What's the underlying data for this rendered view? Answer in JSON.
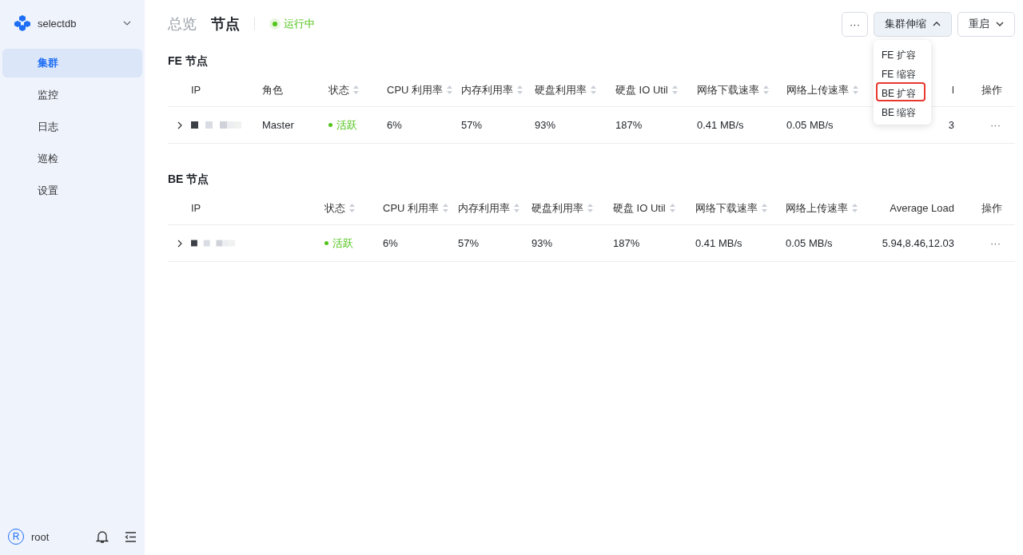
{
  "sidebar": {
    "workspace": "selectdb",
    "items": [
      {
        "label": "集群",
        "selected": true
      },
      {
        "label": "监控",
        "selected": false
      },
      {
        "label": "日志",
        "selected": false
      },
      {
        "label": "巡检",
        "selected": false
      },
      {
        "label": "设置",
        "selected": false
      }
    ],
    "user": {
      "initial": "R",
      "name": "root"
    }
  },
  "header": {
    "breadcrumbs": [
      {
        "label": "总览",
        "selected": false
      },
      {
        "label": "节点",
        "selected": true
      }
    ],
    "status": {
      "label": "运行中",
      "color": "#52c41a"
    },
    "more_button": "···",
    "scale_button": {
      "label": "集群伸缩",
      "expanded": true
    },
    "restart_button": {
      "label": "重启",
      "expanded": false
    },
    "menu": [
      {
        "label": "FE 扩容",
        "highlighted": false
      },
      {
        "label": "FE 缩容",
        "highlighted": false
      },
      {
        "label": "BE 扩容",
        "highlighted": true
      },
      {
        "label": "BE 缩容",
        "highlighted": false
      }
    ]
  },
  "tables": [
    {
      "title": "FE 节点",
      "columns": [
        {
          "label": "IP",
          "sortable": false
        },
        {
          "label": "角色",
          "sortable": false
        },
        {
          "label": "状态",
          "sortable": true
        },
        {
          "label": "CPU 利用率",
          "sortable": true
        },
        {
          "label": "内存利用率",
          "sortable": true
        },
        {
          "label": "硬盘利用率",
          "sortable": true
        },
        {
          "label": "硬盘 IO Util",
          "sortable": true
        },
        {
          "label": "网络下载速率",
          "sortable": true
        },
        {
          "label": "网络上传速率",
          "sortable": true
        },
        {
          "label": "l",
          "sortable": false
        },
        {
          "label": "操作",
          "sortable": false
        }
      ],
      "rows": [
        {
          "expanded": false,
          "cells": [
            {
              "kind": "masked"
            },
            {
              "kind": "text",
              "text": "Master"
            },
            {
              "kind": "status",
              "text": "活跃",
              "color": "#52c41a"
            },
            {
              "kind": "text",
              "text": "6%"
            },
            {
              "kind": "text",
              "text": "57%"
            },
            {
              "kind": "text",
              "text": "93%"
            },
            {
              "kind": "text",
              "text": "187%"
            },
            {
              "kind": "text",
              "text": "0.41 MB/s"
            },
            {
              "kind": "text",
              "text": "0.05 MB/s"
            },
            {
              "kind": "number",
              "text": "3"
            },
            {
              "kind": "more",
              "text": "···"
            }
          ]
        }
      ]
    },
    {
      "title": "BE 节点",
      "columns": [
        {
          "label": "IP",
          "sortable": false
        },
        {
          "label": "状态",
          "sortable": true
        },
        {
          "label": "CPU 利用率",
          "sortable": true
        },
        {
          "label": "内存利用率",
          "sortable": true
        },
        {
          "label": "硬盘利用率",
          "sortable": true
        },
        {
          "label": "硬盘 IO Util",
          "sortable": true
        },
        {
          "label": "网络下载速率",
          "sortable": true
        },
        {
          "label": "网络上传速率",
          "sortable": true
        },
        {
          "label": "Average Load",
          "sortable": false
        },
        {
          "label": "操作",
          "sortable": false
        }
      ],
      "rows": [
        {
          "expanded": false,
          "cells": [
            {
              "kind": "masked"
            },
            {
              "kind": "status",
              "text": "活跃",
              "color": "#52c41a"
            },
            {
              "kind": "text",
              "text": "6%"
            },
            {
              "kind": "text",
              "text": "57%"
            },
            {
              "kind": "text",
              "text": "93%"
            },
            {
              "kind": "text",
              "text": "187%"
            },
            {
              "kind": "text",
              "text": "0.41 MB/s"
            },
            {
              "kind": "text",
              "text": "0.05 MB/s"
            },
            {
              "kind": "number",
              "text": "5.94,8.46,12.03"
            },
            {
              "kind": "more",
              "text": "···"
            }
          ]
        }
      ]
    }
  ]
}
